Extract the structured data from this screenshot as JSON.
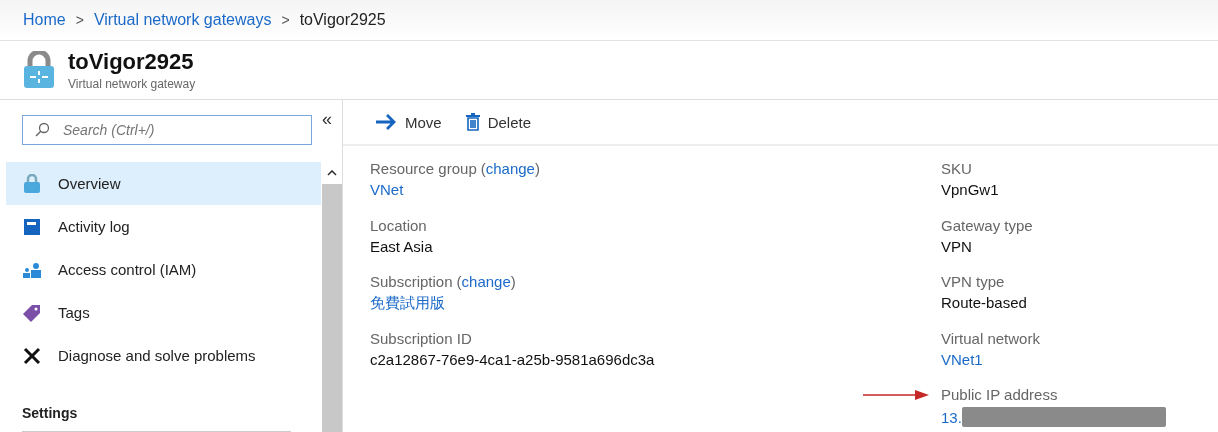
{
  "breadcrumb": [
    {
      "label": "Home",
      "kind": "link"
    },
    {
      "label": "Virtual network gateways",
      "kind": "link"
    },
    {
      "label": "toVigor2925",
      "kind": "current"
    }
  ],
  "separator": ">",
  "header": {
    "title": "toVigor2925",
    "subtitle": "Virtual network gateway"
  },
  "sidebar": {
    "collapse": "«",
    "search": {
      "placeholder": "Search (Ctrl+/)"
    },
    "items": [
      {
        "label": "Overview",
        "selected": true
      },
      {
        "label": "Activity log",
        "selected": false
      },
      {
        "label": "Access control (IAM)",
        "selected": false
      },
      {
        "label": "Tags",
        "selected": false
      },
      {
        "label": "Diagnose and solve problems",
        "selected": false
      }
    ],
    "section": "Settings"
  },
  "toolbar": [
    {
      "label": "Move"
    },
    {
      "label": "Delete"
    }
  ],
  "left_fields": [
    {
      "label": "Resource group",
      "change": {
        "open": "(",
        "link": "change",
        "close": ")"
      },
      "value": "VNet",
      "kind": "link"
    },
    {
      "label": "Location",
      "value": "East Asia",
      "kind": "text"
    },
    {
      "label": "Subscription",
      "change": {
        "open": "(",
        "link": "change",
        "close": ")"
      },
      "value": "免費試用版",
      "kind": "link"
    },
    {
      "label": "Subscription ID",
      "value": "c2a12867-76e9-4ca1-a25b-9581a696dc3a",
      "kind": "text"
    }
  ],
  "right_fields": [
    {
      "label": "SKU",
      "value": "VpnGw1",
      "kind": "text"
    },
    {
      "label": "Gateway type",
      "value": "VPN",
      "kind": "text"
    },
    {
      "label": "VPN type",
      "value": "Route-based",
      "kind": "text"
    },
    {
      "label": "Virtual network",
      "value": "VNet1",
      "kind": "link"
    },
    {
      "label": "Public IP address",
      "value": "13.",
      "kind": "redacted"
    }
  ]
}
